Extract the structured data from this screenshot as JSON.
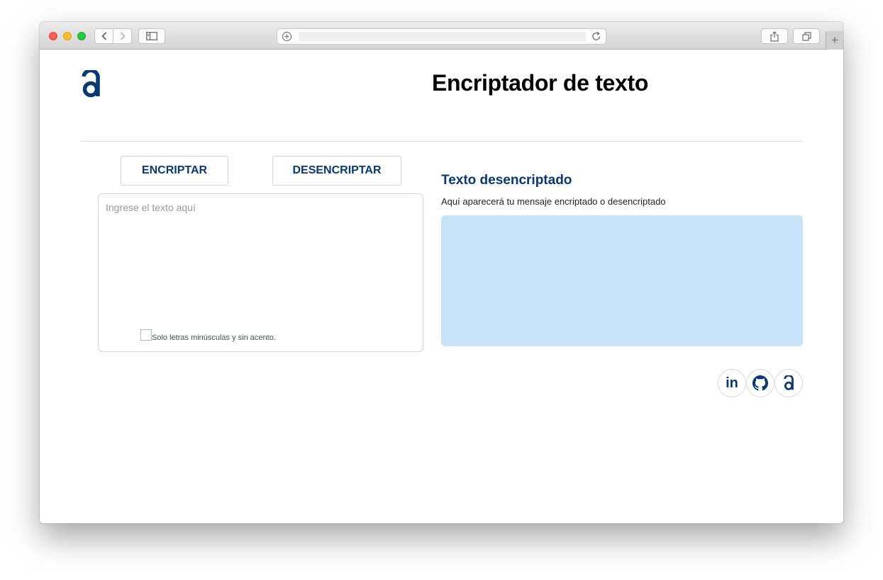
{
  "browser": {
    "url": "",
    "icons": {
      "back": "chevron-left-icon",
      "forward": "chevron-right-icon",
      "sidebar": "sidebar-icon",
      "add": "plus-circle-icon",
      "reload": "reload-icon",
      "share": "share-icon",
      "tabs": "tabs-icon",
      "new_tab": "+"
    }
  },
  "header": {
    "logo": "alura-logo-icon",
    "title": "Encriptador de texto"
  },
  "actions": {
    "encrypt_label": "ENCRIPTAR",
    "decrypt_label": "DESENCRIPTAR"
  },
  "input": {
    "placeholder": "Ingrese el texto aquí",
    "value": "",
    "checkbox_label": "Solo letras minúsculas y sin acento."
  },
  "output": {
    "title": "Texto desencriptado",
    "subtitle": "Aquí aparecerá tu mensaje encriptado o desencriptado",
    "content": ""
  },
  "social": {
    "linkedin_label": "in",
    "icons": [
      "linkedin-icon",
      "github-icon",
      "alura-icon"
    ]
  },
  "colors": {
    "brand": "#0a3871",
    "output_bg": "#c8e3f8",
    "divider": "#dcdcdc"
  }
}
